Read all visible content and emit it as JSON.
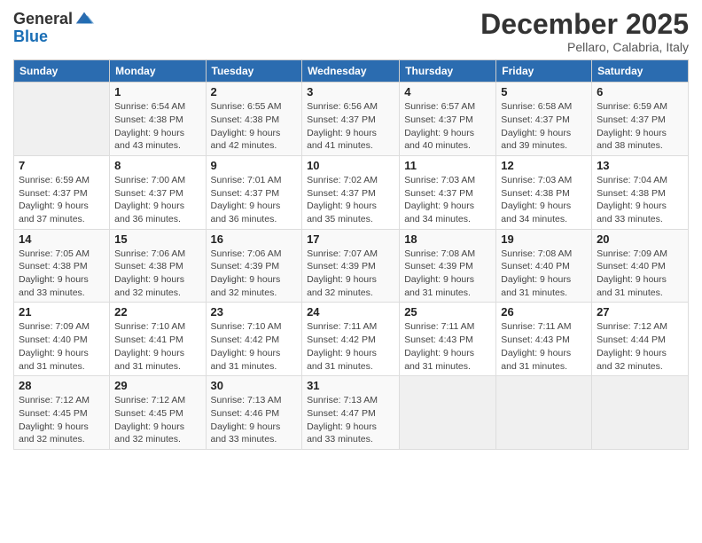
{
  "header": {
    "logo_general": "General",
    "logo_blue": "Blue",
    "month_title": "December 2025",
    "location": "Pellaro, Calabria, Italy"
  },
  "days_of_week": [
    "Sunday",
    "Monday",
    "Tuesday",
    "Wednesday",
    "Thursday",
    "Friday",
    "Saturday"
  ],
  "weeks": [
    [
      {
        "day": "",
        "info": ""
      },
      {
        "day": "1",
        "info": "Sunrise: 6:54 AM\nSunset: 4:38 PM\nDaylight: 9 hours\nand 43 minutes."
      },
      {
        "day": "2",
        "info": "Sunrise: 6:55 AM\nSunset: 4:38 PM\nDaylight: 9 hours\nand 42 minutes."
      },
      {
        "day": "3",
        "info": "Sunrise: 6:56 AM\nSunset: 4:37 PM\nDaylight: 9 hours\nand 41 minutes."
      },
      {
        "day": "4",
        "info": "Sunrise: 6:57 AM\nSunset: 4:37 PM\nDaylight: 9 hours\nand 40 minutes."
      },
      {
        "day": "5",
        "info": "Sunrise: 6:58 AM\nSunset: 4:37 PM\nDaylight: 9 hours\nand 39 minutes."
      },
      {
        "day": "6",
        "info": "Sunrise: 6:59 AM\nSunset: 4:37 PM\nDaylight: 9 hours\nand 38 minutes."
      }
    ],
    [
      {
        "day": "7",
        "info": "Sunrise: 6:59 AM\nSunset: 4:37 PM\nDaylight: 9 hours\nand 37 minutes."
      },
      {
        "day": "8",
        "info": "Sunrise: 7:00 AM\nSunset: 4:37 PM\nDaylight: 9 hours\nand 36 minutes."
      },
      {
        "day": "9",
        "info": "Sunrise: 7:01 AM\nSunset: 4:37 PM\nDaylight: 9 hours\nand 36 minutes."
      },
      {
        "day": "10",
        "info": "Sunrise: 7:02 AM\nSunset: 4:37 PM\nDaylight: 9 hours\nand 35 minutes."
      },
      {
        "day": "11",
        "info": "Sunrise: 7:03 AM\nSunset: 4:37 PM\nDaylight: 9 hours\nand 34 minutes."
      },
      {
        "day": "12",
        "info": "Sunrise: 7:03 AM\nSunset: 4:38 PM\nDaylight: 9 hours\nand 34 minutes."
      },
      {
        "day": "13",
        "info": "Sunrise: 7:04 AM\nSunset: 4:38 PM\nDaylight: 9 hours\nand 33 minutes."
      }
    ],
    [
      {
        "day": "14",
        "info": "Sunrise: 7:05 AM\nSunset: 4:38 PM\nDaylight: 9 hours\nand 33 minutes."
      },
      {
        "day": "15",
        "info": "Sunrise: 7:06 AM\nSunset: 4:38 PM\nDaylight: 9 hours\nand 32 minutes."
      },
      {
        "day": "16",
        "info": "Sunrise: 7:06 AM\nSunset: 4:39 PM\nDaylight: 9 hours\nand 32 minutes."
      },
      {
        "day": "17",
        "info": "Sunrise: 7:07 AM\nSunset: 4:39 PM\nDaylight: 9 hours\nand 32 minutes."
      },
      {
        "day": "18",
        "info": "Sunrise: 7:08 AM\nSunset: 4:39 PM\nDaylight: 9 hours\nand 31 minutes."
      },
      {
        "day": "19",
        "info": "Sunrise: 7:08 AM\nSunset: 4:40 PM\nDaylight: 9 hours\nand 31 minutes."
      },
      {
        "day": "20",
        "info": "Sunrise: 7:09 AM\nSunset: 4:40 PM\nDaylight: 9 hours\nand 31 minutes."
      }
    ],
    [
      {
        "day": "21",
        "info": "Sunrise: 7:09 AM\nSunset: 4:40 PM\nDaylight: 9 hours\nand 31 minutes."
      },
      {
        "day": "22",
        "info": "Sunrise: 7:10 AM\nSunset: 4:41 PM\nDaylight: 9 hours\nand 31 minutes."
      },
      {
        "day": "23",
        "info": "Sunrise: 7:10 AM\nSunset: 4:42 PM\nDaylight: 9 hours\nand 31 minutes."
      },
      {
        "day": "24",
        "info": "Sunrise: 7:11 AM\nSunset: 4:42 PM\nDaylight: 9 hours\nand 31 minutes."
      },
      {
        "day": "25",
        "info": "Sunrise: 7:11 AM\nSunset: 4:43 PM\nDaylight: 9 hours\nand 31 minutes."
      },
      {
        "day": "26",
        "info": "Sunrise: 7:11 AM\nSunset: 4:43 PM\nDaylight: 9 hours\nand 31 minutes."
      },
      {
        "day": "27",
        "info": "Sunrise: 7:12 AM\nSunset: 4:44 PM\nDaylight: 9 hours\nand 32 minutes."
      }
    ],
    [
      {
        "day": "28",
        "info": "Sunrise: 7:12 AM\nSunset: 4:45 PM\nDaylight: 9 hours\nand 32 minutes."
      },
      {
        "day": "29",
        "info": "Sunrise: 7:12 AM\nSunset: 4:45 PM\nDaylight: 9 hours\nand 32 minutes."
      },
      {
        "day": "30",
        "info": "Sunrise: 7:13 AM\nSunset: 4:46 PM\nDaylight: 9 hours\nand 33 minutes."
      },
      {
        "day": "31",
        "info": "Sunrise: 7:13 AM\nSunset: 4:47 PM\nDaylight: 9 hours\nand 33 minutes."
      },
      {
        "day": "",
        "info": ""
      },
      {
        "day": "",
        "info": ""
      },
      {
        "day": "",
        "info": ""
      }
    ]
  ]
}
